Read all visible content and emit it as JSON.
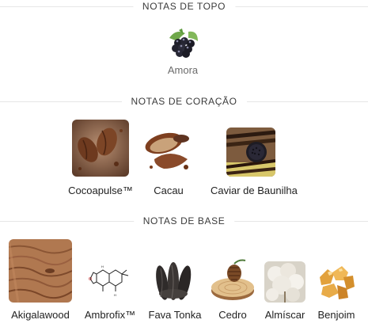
{
  "sections": {
    "top": {
      "title": "NOTAS DE TOPO",
      "notes": [
        {
          "label": "Amora",
          "icon": "blackberry-icon"
        }
      ]
    },
    "heart": {
      "title": "NOTAS DE CORAÇÃO",
      "notes": [
        {
          "label": "Cocoapulse™",
          "icon": "cocoa-pods-icon"
        },
        {
          "label": "Cacau",
          "icon": "cocoa-powder-icon"
        },
        {
          "label": "Caviar de Baunilha",
          "icon": "vanilla-caviar-icon"
        }
      ]
    },
    "base": {
      "title": "NOTAS DE BASE",
      "notes": [
        {
          "label": "Akigalawood",
          "icon": "wood-grain-icon"
        },
        {
          "label": "Ambrofix™",
          "icon": "molecule-structure-icon"
        },
        {
          "label": "Fava Tonka",
          "icon": "tonka-beans-icon"
        },
        {
          "label": "Cedro",
          "icon": "cedar-cone-icon"
        },
        {
          "label": "Almíscar",
          "icon": "musk-cotton-icon"
        },
        {
          "label": "Benjoim",
          "icon": "benzoin-resin-icon"
        }
      ]
    }
  }
}
